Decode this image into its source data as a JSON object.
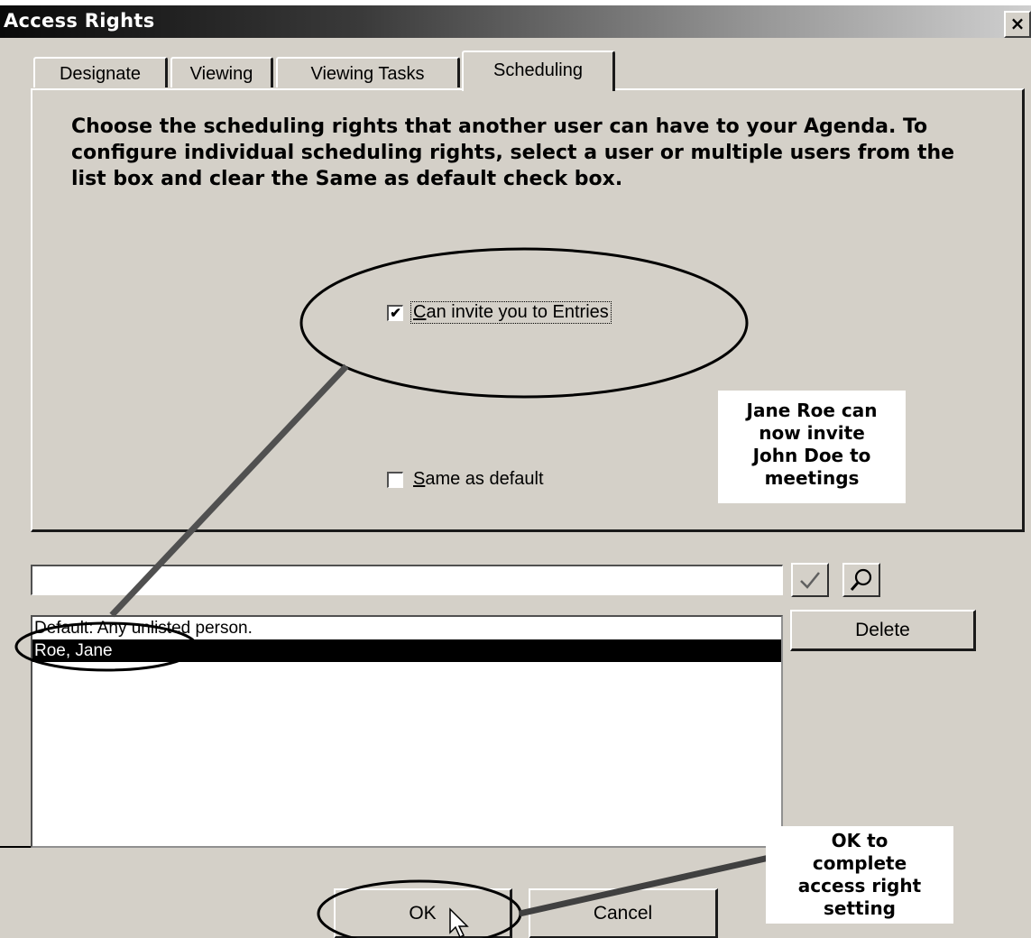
{
  "window": {
    "title": "Access Rights",
    "close_label": "×"
  },
  "tabs": [
    {
      "label": "Designate",
      "active": false
    },
    {
      "label": "Viewing",
      "active": false
    },
    {
      "label": "Viewing Tasks",
      "active": false
    },
    {
      "label": "Scheduling",
      "active": true
    }
  ],
  "scheduling": {
    "instructions": "Choose the scheduling rights that another user can have to your Agenda. To configure individual scheduling rights, select a user or multiple users from the list box and clear the Same as default check box.",
    "invite_checkbox": {
      "label_mnemonic": "C",
      "label_rest": "an invite you to Entries",
      "checked": true,
      "mark": "✔"
    },
    "same_default_checkbox": {
      "label_mnemonic": "S",
      "label_rest": "ame as default",
      "checked": false,
      "mark": ""
    }
  },
  "user_search": {
    "value": "",
    "placeholder": ""
  },
  "icons": {
    "check_button": "check-icon",
    "search_button": "magnifier-icon"
  },
  "user_list": [
    {
      "text": "Default: Any unlisted person.",
      "selected": false
    },
    {
      "text": "Roe, Jane",
      "selected": true
    }
  ],
  "buttons": {
    "delete": "Delete",
    "ok": "OK",
    "cancel": "Cancel"
  },
  "annotations": {
    "note_top": [
      "Jane Roe can",
      "now invite",
      "John Doe to",
      "meetings"
    ],
    "note_bottom": [
      "OK to",
      "complete",
      "access right",
      "setting"
    ]
  }
}
